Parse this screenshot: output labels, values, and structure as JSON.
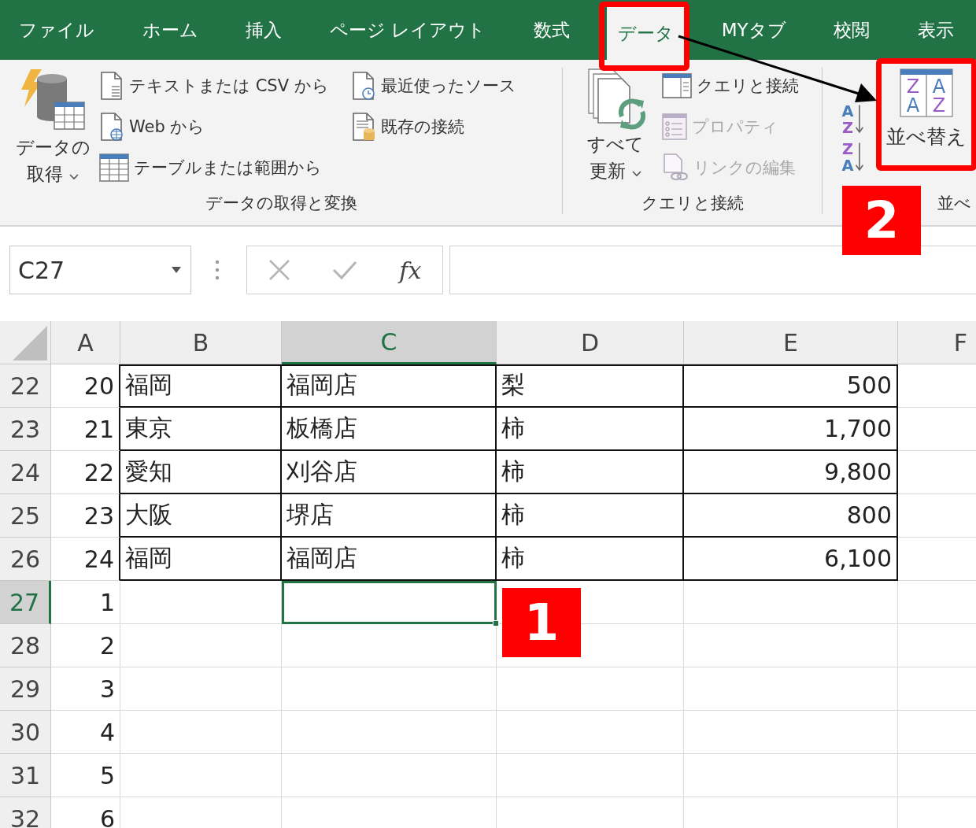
{
  "tabs": [
    {
      "label": "ファイル",
      "selected": false
    },
    {
      "label": "ホーム",
      "selected": false
    },
    {
      "label": "挿入",
      "selected": false
    },
    {
      "label": "ページ レイアウト",
      "selected": false
    },
    {
      "label": "数式",
      "selected": false
    },
    {
      "label": "データ",
      "selected": true
    },
    {
      "label": "MYタブ",
      "selected": false
    },
    {
      "label": "校閲",
      "selected": false
    },
    {
      "label": "表示",
      "selected": false
    }
  ],
  "ribbon": {
    "get_transform": {
      "label": "データの取得と変換",
      "get_data": {
        "lines": [
          "データの",
          "取得"
        ]
      },
      "columns": [
        [
          {
            "label": "テキストまたは CSV から"
          },
          {
            "label": "Web から"
          },
          {
            "label": "テーブルまたは範囲から"
          }
        ],
        [
          {
            "label": "最近使ったソース"
          },
          {
            "label": "既存の接続"
          }
        ]
      ]
    },
    "queries": {
      "label": "クエリと接続",
      "refresh_all": {
        "lines": [
          "すべて",
          "更新"
        ]
      },
      "commands": [
        {
          "label": "クエリと接続",
          "disabled": false
        },
        {
          "label": "プロパティ",
          "disabled": true
        },
        {
          "label": "リンクの編集",
          "disabled": true
        }
      ]
    },
    "sort_filter": {
      "label": "並べ",
      "sort_ascending": [
        "A",
        "Z"
      ],
      "sort_descending": [
        "Z",
        "A"
      ],
      "sort": {
        "label": "並べ替え",
        "glyphs": [
          [
            "Z",
            "A"
          ],
          [
            "A",
            "Z"
          ]
        ]
      }
    }
  },
  "formula_bar": {
    "name_box": "C27",
    "function_button": "fx"
  },
  "grid": {
    "columns": [
      {
        "label": "A",
        "selected": false
      },
      {
        "label": "B",
        "selected": false
      },
      {
        "label": "C",
        "selected": true
      },
      {
        "label": "D",
        "selected": false
      },
      {
        "label": "E",
        "selected": false
      },
      {
        "label": "F",
        "selected": false
      }
    ],
    "rows": [
      {
        "header": "22",
        "selected": false,
        "bordered": true,
        "cells": [
          "20",
          "福岡",
          "福岡店",
          "梨",
          "500"
        ]
      },
      {
        "header": "23",
        "selected": false,
        "bordered": true,
        "cells": [
          "21",
          "東京",
          "板橋店",
          "柿",
          "1,700"
        ]
      },
      {
        "header": "24",
        "selected": false,
        "bordered": true,
        "cells": [
          "22",
          "愛知",
          "刈谷店",
          "柿",
          "9,800"
        ]
      },
      {
        "header": "25",
        "selected": false,
        "bordered": true,
        "cells": [
          "23",
          "大阪",
          "堺店",
          "柿",
          "800"
        ]
      },
      {
        "header": "26",
        "selected": false,
        "bordered": true,
        "cells": [
          "24",
          "福岡",
          "福岡店",
          "柿",
          "6,100"
        ]
      },
      {
        "header": "27",
        "selected": true,
        "bordered": false,
        "cells": [
          "1"
        ]
      },
      {
        "header": "28",
        "selected": false,
        "bordered": false,
        "cells": [
          "2"
        ]
      },
      {
        "header": "29",
        "selected": false,
        "bordered": false,
        "cells": [
          "3"
        ]
      },
      {
        "header": "30",
        "selected": false,
        "bordered": false,
        "cells": [
          "4"
        ]
      },
      {
        "header": "31",
        "selected": false,
        "bordered": false,
        "cells": [
          "5"
        ]
      },
      {
        "header": "32",
        "selected": false,
        "bordered": false,
        "cells": [
          "6"
        ]
      }
    ]
  },
  "callouts": [
    {
      "label": "1"
    },
    {
      "label": "2"
    }
  ]
}
